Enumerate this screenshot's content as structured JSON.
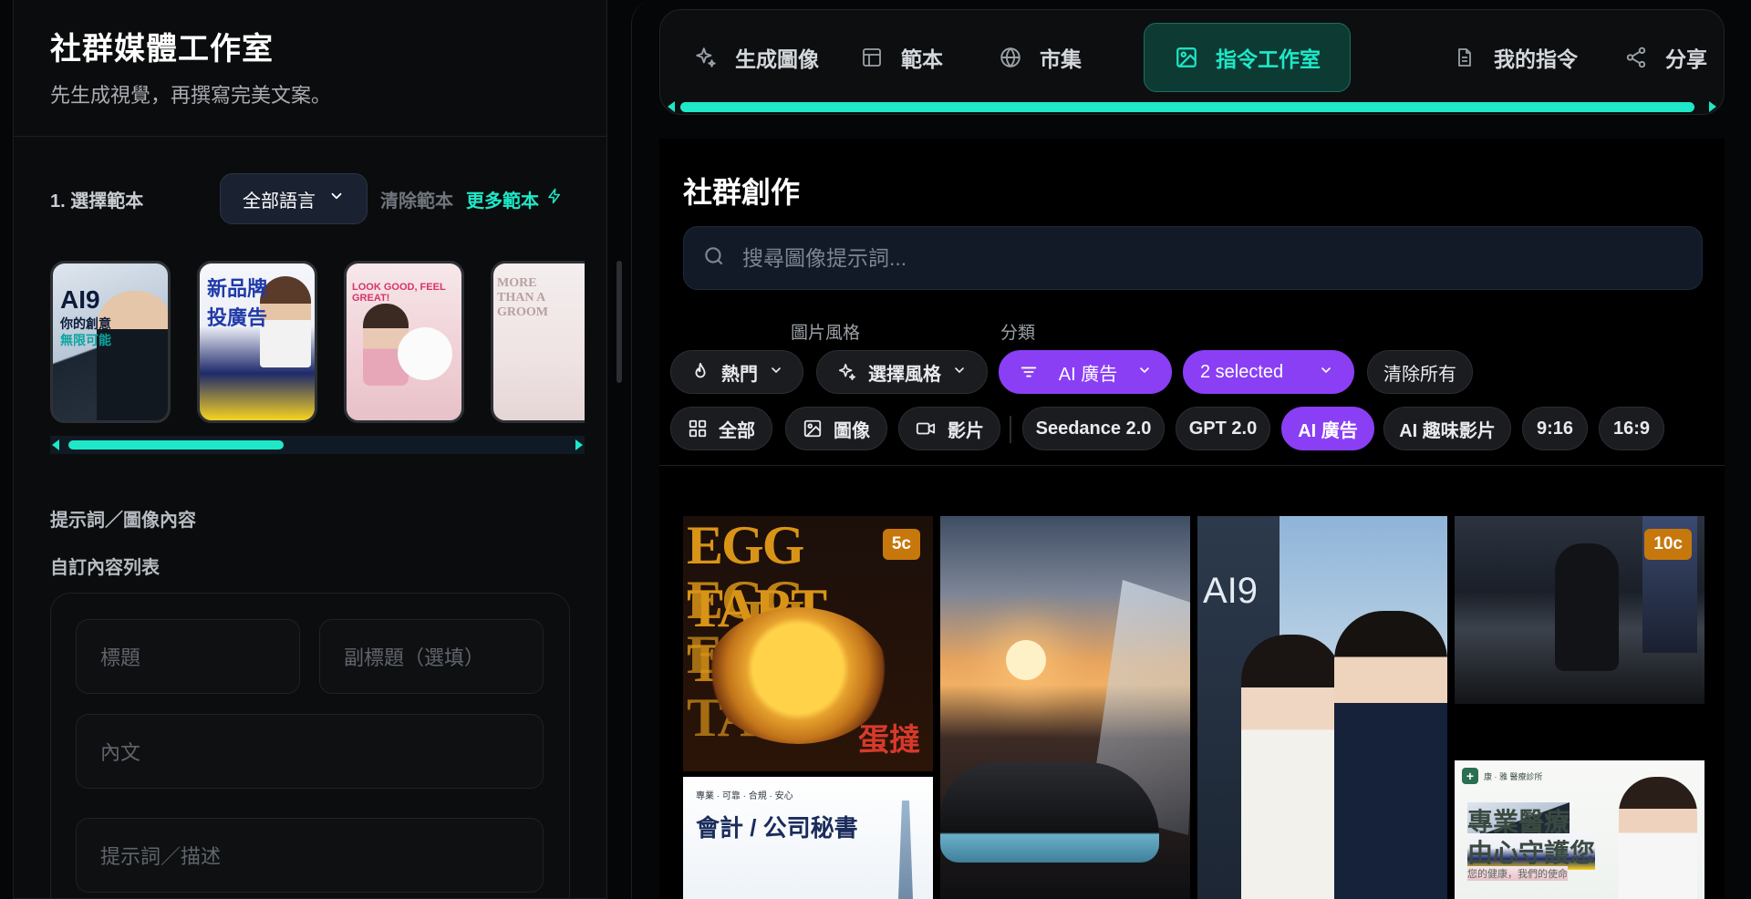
{
  "left": {
    "title": "社群媒體工作室",
    "subtitle": "先生成視覺，再撰寫完美文案。",
    "step1": {
      "label": "1. 選擇範本",
      "language": "全部語言",
      "clear": "清除範本",
      "more": "更多範本"
    },
    "templates": [
      {
        "title": "AI9",
        "line2": "你的創意",
        "line3": "無限可能"
      },
      {
        "title": "新品牌",
        "line2": "投廣告"
      },
      {
        "title": "LOOK GOOD, FEEL GREAT!"
      },
      {
        "title": "MORE THAN A GROOM"
      }
    ],
    "prompt_section_label": "提示詞／圖像內容",
    "custom_list_label": "自訂內容列表",
    "fields": {
      "title_placeholder": "標題",
      "subtitle_placeholder": "副標題（選填）",
      "body_placeholder": "內文",
      "prompt_placeholder": "提示詞／描述"
    }
  },
  "nav": {
    "items": [
      {
        "label": "生成圖像",
        "icon": "sparkle-icon"
      },
      {
        "label": "範本",
        "icon": "layout-icon"
      },
      {
        "label": "市集",
        "icon": "globe-icon"
      },
      {
        "label": "指令工作室",
        "icon": "image-icon",
        "active": true
      },
      {
        "label": "我的指令",
        "icon": "document-icon"
      },
      {
        "label": "分享",
        "icon": "share-icon"
      }
    ]
  },
  "main": {
    "section_title": "社群創作",
    "search_placeholder": "搜尋圖像提示詞...",
    "caption_style": "圖片風格",
    "caption_category": "分類",
    "filters_row1": {
      "hot": "熱門",
      "style": "選擇風格",
      "category": "AI 廣告",
      "selected": "2 selected",
      "clear_all": "清除所有"
    },
    "filters_row2": {
      "all": "全部",
      "image": "圖像",
      "video": "影片",
      "seedance": "Seedance 2.0",
      "gpt": "GPT 2.0",
      "ai_ad": "AI 廣告",
      "ai_fun": "AI 趣味影片",
      "r916": "9:16",
      "r169": "16:9"
    },
    "gallery": {
      "egg_tart_text": "EGG TART",
      "egg_tart_cn": "蛋撻",
      "egg_tart_credit": "5c",
      "accounting_tagline": "專業 · 可靠 · 合規 · 安心",
      "accounting_title": "會計 / 公司秘書",
      "couple_logo": "AI9",
      "runner_credit": "10c",
      "medical_header": "康 · 雅 醫療診所",
      "medical_line1": "專業醫療",
      "medical_line2": "由心守護您",
      "medical_line3": "您的健康，我們的使命"
    }
  },
  "colors": {
    "accent": "#1ee8c8",
    "purple": "#8a3ff5",
    "badge": "#c7780c"
  }
}
